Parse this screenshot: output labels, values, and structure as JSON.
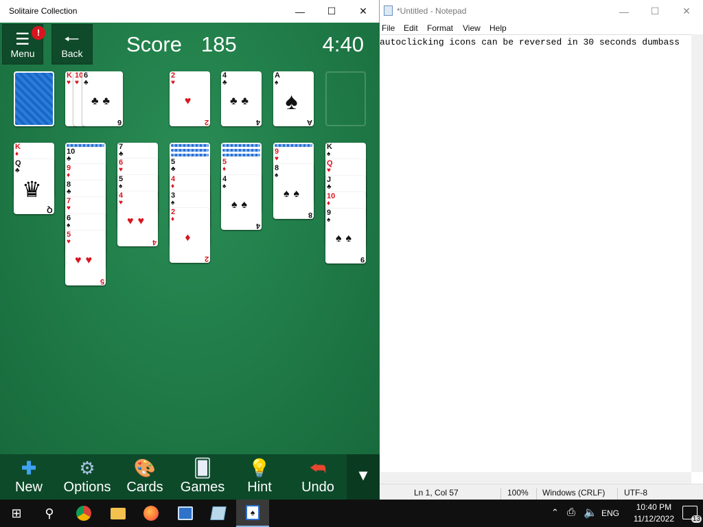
{
  "solitaire": {
    "title": "Solitaire Collection",
    "menu_label": "Menu",
    "back_label": "Back",
    "score_label": "Score",
    "score_value": "185",
    "timer": "4:40",
    "alert": "!"
  },
  "cards": {
    "waste_a": "K",
    "waste_b": "10",
    "waste_c": "6",
    "found1": "2",
    "found2": "4",
    "found3": "A",
    "t1a": "K",
    "t1b": "Q",
    "t2a": "10",
    "t2b": "9",
    "t2c": "8",
    "t2d": "7",
    "t2e": "6",
    "t2f": "5",
    "t3a": "7",
    "t3b": "6",
    "t3c": "5",
    "t3d": "4",
    "t4a": "5",
    "t4b": "4",
    "t4c": "3",
    "t4d": "2",
    "t5a": "5",
    "t5b": "4",
    "t6a": "9",
    "t6b": "8",
    "t7a": "K",
    "t7b": "Q",
    "t7c": "J",
    "t7d": "10",
    "t7e": "9"
  },
  "bottom_bar": {
    "new": "New",
    "options": "Options",
    "cards": "Cards",
    "games": "Games",
    "hint": "Hint",
    "undo": "Undo"
  },
  "notepad": {
    "title": "*Untitled - Notepad",
    "menu": [
      "File",
      "Edit",
      "Format",
      "View",
      "Help"
    ],
    "text": "autoclicking icons can be reversed in 30 seconds dumbass",
    "status": {
      "position": "Ln 1, Col 57",
      "zoom": "100%",
      "eol": "Windows (CRLF)",
      "encoding": "UTF-8"
    }
  },
  "taskbar": {
    "lang": "ENG",
    "time": "10:40 PM",
    "date": "11/12/2022",
    "notif_count": "13"
  }
}
